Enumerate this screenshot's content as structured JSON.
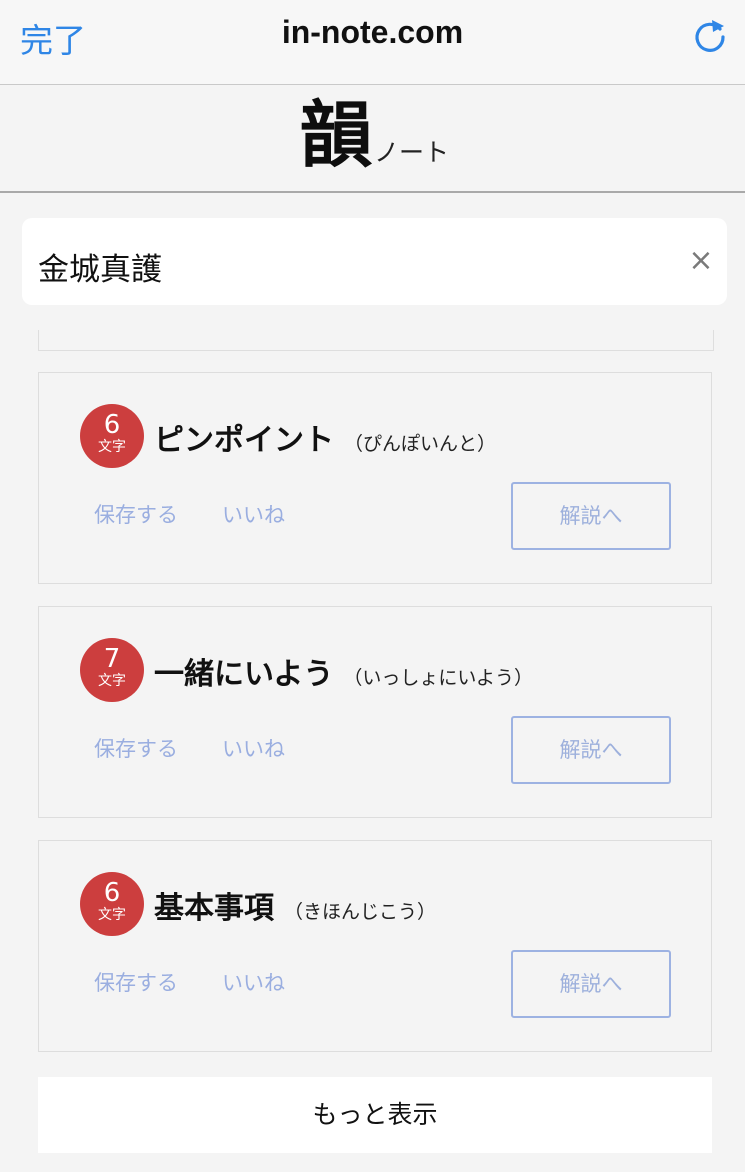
{
  "browser": {
    "done_label": "完了",
    "url": "in-note.com",
    "reload_icon": "reload-icon"
  },
  "site": {
    "logo_kanji": "韻",
    "logo_sub": "ノート"
  },
  "search": {
    "value": "金城真護",
    "clear_icon": "close-icon",
    "clear_glyph": "×"
  },
  "results": [
    {
      "count": "6",
      "unit": "文字",
      "word": "ピンポイント",
      "reading": "（ぴんぽいんと）",
      "save_label": "保存する",
      "like_label": "いいね",
      "explain_label": "解説へ"
    },
    {
      "count": "7",
      "unit": "文字",
      "word": "一緒にいよう",
      "reading": "（いっしょにいよう）",
      "save_label": "保存する",
      "like_label": "いいね",
      "explain_label": "解説へ"
    },
    {
      "count": "6",
      "unit": "文字",
      "word": "基本事項",
      "reading": "（きほんじこう）",
      "save_label": "保存する",
      "like_label": "いいね",
      "explain_label": "解説へ"
    }
  ],
  "more_label": "もっと表示",
  "colors": {
    "accent_blue": "#2f86e6",
    "badge_red": "#cc3e3e",
    "link_lavender": "#9aaee0"
  }
}
